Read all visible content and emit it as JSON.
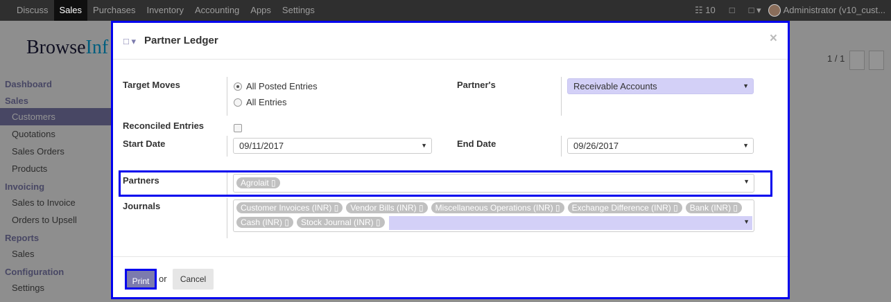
{
  "navbar": {
    "menu": [
      "Discuss",
      "Sales",
      "Purchases",
      "Inventory",
      "Accounting",
      "Apps",
      "Settings"
    ],
    "active": "Sales",
    "message_count": "10",
    "user": "Administrator (v10_cust..."
  },
  "background": {
    "logo_left": "Browse",
    "logo_right": "Inf",
    "pager": "1 / 1",
    "sidebar": [
      {
        "type": "head",
        "label": "Dashboard"
      },
      {
        "type": "head",
        "label": "Sales"
      },
      {
        "type": "item",
        "label": "Customers",
        "selected": true
      },
      {
        "type": "item",
        "label": "Quotations"
      },
      {
        "type": "item",
        "label": "Sales Orders"
      },
      {
        "type": "item",
        "label": "Products"
      },
      {
        "type": "head",
        "label": "Invoicing"
      },
      {
        "type": "item",
        "label": "Sales to Invoice"
      },
      {
        "type": "item",
        "label": "Orders to Upsell"
      },
      {
        "type": "head",
        "label": "Reports"
      },
      {
        "type": "item",
        "label": "Sales"
      },
      {
        "type": "head",
        "label": "Configuration"
      },
      {
        "type": "item",
        "label": "Settings"
      }
    ]
  },
  "dialog": {
    "title": "Partner Ledger",
    "close": "×",
    "target_moves": {
      "label": "Target Moves",
      "options": [
        {
          "label": "All Posted Entries",
          "checked": true
        },
        {
          "label": "All Entries",
          "checked": false
        }
      ]
    },
    "partners_type": {
      "label": "Partner's",
      "value": "Receivable Accounts"
    },
    "reconciled": {
      "label": "Reconciled Entries",
      "checked": false
    },
    "start_date": {
      "label": "Start Date",
      "value": "09/11/2017"
    },
    "end_date": {
      "label": "End Date",
      "value": "09/26/2017"
    },
    "partners": {
      "label": "Partners",
      "tags": [
        "Agrolait"
      ]
    },
    "journals": {
      "label": "Journals",
      "row1": [
        "Customer Invoices (INR)",
        "Vendor Bills (INR)",
        "Miscellaneous Operations (INR)",
        "Exchange Difference (INR)",
        "Bank (INR)"
      ],
      "row2": [
        "Cash (INR)",
        "Stock Journal (INR)"
      ]
    },
    "print_label": "Print",
    "or_label": "or",
    "cancel_label": "Cancel"
  }
}
